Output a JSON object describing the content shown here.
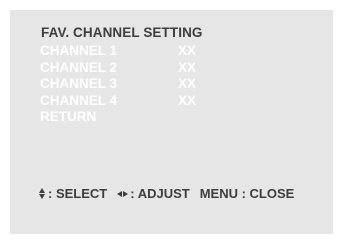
{
  "osd": {
    "title": "FAV. CHANNEL SETTING",
    "items": [
      {
        "label": "CHANNEL 1",
        "value": "XX"
      },
      {
        "label": "CHANNEL 2",
        "value": "XX"
      },
      {
        "label": "CHANNEL 3",
        "value": "XX"
      },
      {
        "label": "CHANNEL 4",
        "value": "XX"
      },
      {
        "label": "RETURN",
        "value": ""
      }
    ],
    "help": {
      "select": ": SELECT",
      "adjust": ": ADJUST",
      "close": "MENU : CLOSE"
    },
    "icons": {
      "select": "up-down-arrows-icon",
      "adjust": "left-right-arrows-icon"
    },
    "colors": {
      "panel_background": "#e6e6e6",
      "heading_text": "#3d3d3d",
      "item_text": "#ffffff"
    }
  }
}
